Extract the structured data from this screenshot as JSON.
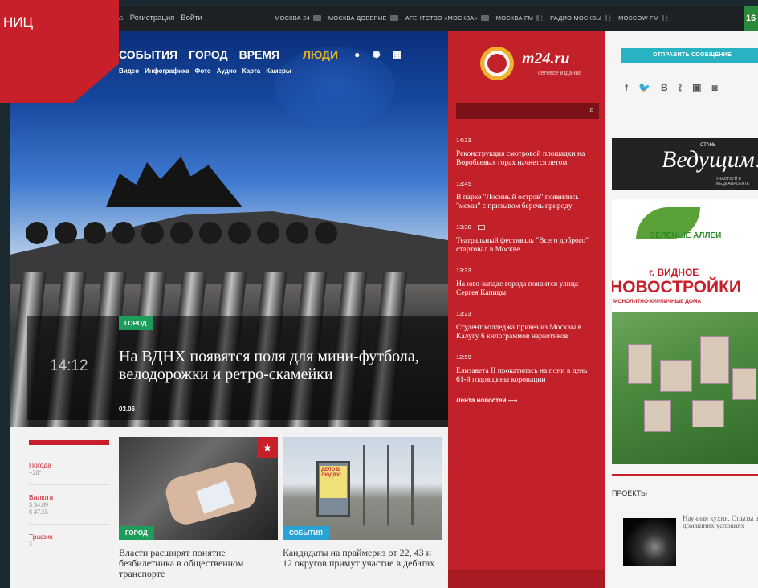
{
  "ribbon": {
    "text": "НИЦ"
  },
  "topbar": {
    "auth": [
      "Регистрация",
      "Войти"
    ],
    "channels": [
      "МОСКВА 24",
      "МОСКВА ДОВЕРИЕ",
      "АГЕНТСТВО «МОСКВА»",
      "МОСКВА FM",
      "РАДИО МОСКВЫ",
      "MOSCOW FM"
    ],
    "temp": "16"
  },
  "nav": {
    "items": [
      "СОБЫТИЯ",
      "ГОРОД",
      "ВРЕМЯ",
      "ЛЮДИ"
    ],
    "sub": [
      "Видео",
      "Инфографика",
      "Фото",
      "Аудио",
      "Карта",
      "Камеры"
    ]
  },
  "hero": {
    "badge": "ГОРОД",
    "time": "14:12",
    "title": "На ВДНХ появятся поля для мини-футбола, велодорожки и ретро-скамейки",
    "date": "03.06"
  },
  "info": [
    {
      "label": "Погода",
      "value": "+28°"
    },
    {
      "label": "Валюта",
      "value": "$ 34.89\n€ 47.55"
    },
    {
      "label": "Трафик",
      "value": "3"
    }
  ],
  "cards": [
    {
      "tag": "ГОРОД",
      "title": "Власти расширят понятие безбилетника в общественном транспорте"
    },
    {
      "tag": "СОБЫТИЯ",
      "title": "Кандидаты на праймериз от 22, 43 и 12 округов примут участие в дебатах",
      "sign": "ДЕЛО В ЛЮДЯХ!"
    }
  ],
  "news": {
    "brand": "m24.ru",
    "brand_sub": "сетевое издание",
    "entries": [
      {
        "time": "14:33",
        "text": "Реконструкция смотровой площадки на Воробьевых горах начнется летом"
      },
      {
        "time": "13:45",
        "text": "В парке \"Лосиный остров\" появились \"мемы\" с призывом беречь природу"
      },
      {
        "time": "13:38",
        "text": "Театральный фестиваль \"Всего доброго\" стартовал в Москве"
      },
      {
        "time": "13:33",
        "text": "На юго-западе города появится улица Сергея Капицы"
      },
      {
        "time": "13:23",
        "text": "Студент колледжа привез из Москвы в Калугу 6 килограммов наркотиков"
      },
      {
        "time": "12:59",
        "text": "Елизавета II прокатилась на пони в день 61-й годовщины коронации"
      }
    ],
    "more": "Лента новостей"
  },
  "right": {
    "send": "ОТПРАВИТЬ СООБЩЕНИЕ",
    "social": [
      "f",
      "🐦",
      "В",
      "RSS",
      "You",
      "Ig"
    ],
    "ad1": {
      "stan": "СТАНЬ",
      "ved": "Ведущим!",
      "small": "УЧАСТВУЙ В МЕДИАПРОЕКТЕ"
    },
    "ad2": {
      "zel": "ЗЕЛЕНЫЕ АЛЛЕИ",
      "vid": "г. ВИДНОЕ",
      "novo": "НОВОСТРОЙКИ",
      "mono": "МОНОЛИТНО-КИРПИЧНЫЕ ДОМА"
    },
    "projects_title": "ПРОЕКТЫ",
    "project": "Научная кухня. Опыты в домашних условиях"
  },
  "colors": {
    "accent_red": "#c32129",
    "green_tag": "#1e9c5a",
    "blue_tag": "#29a3d6",
    "cyan_button": "#27b3c2"
  }
}
